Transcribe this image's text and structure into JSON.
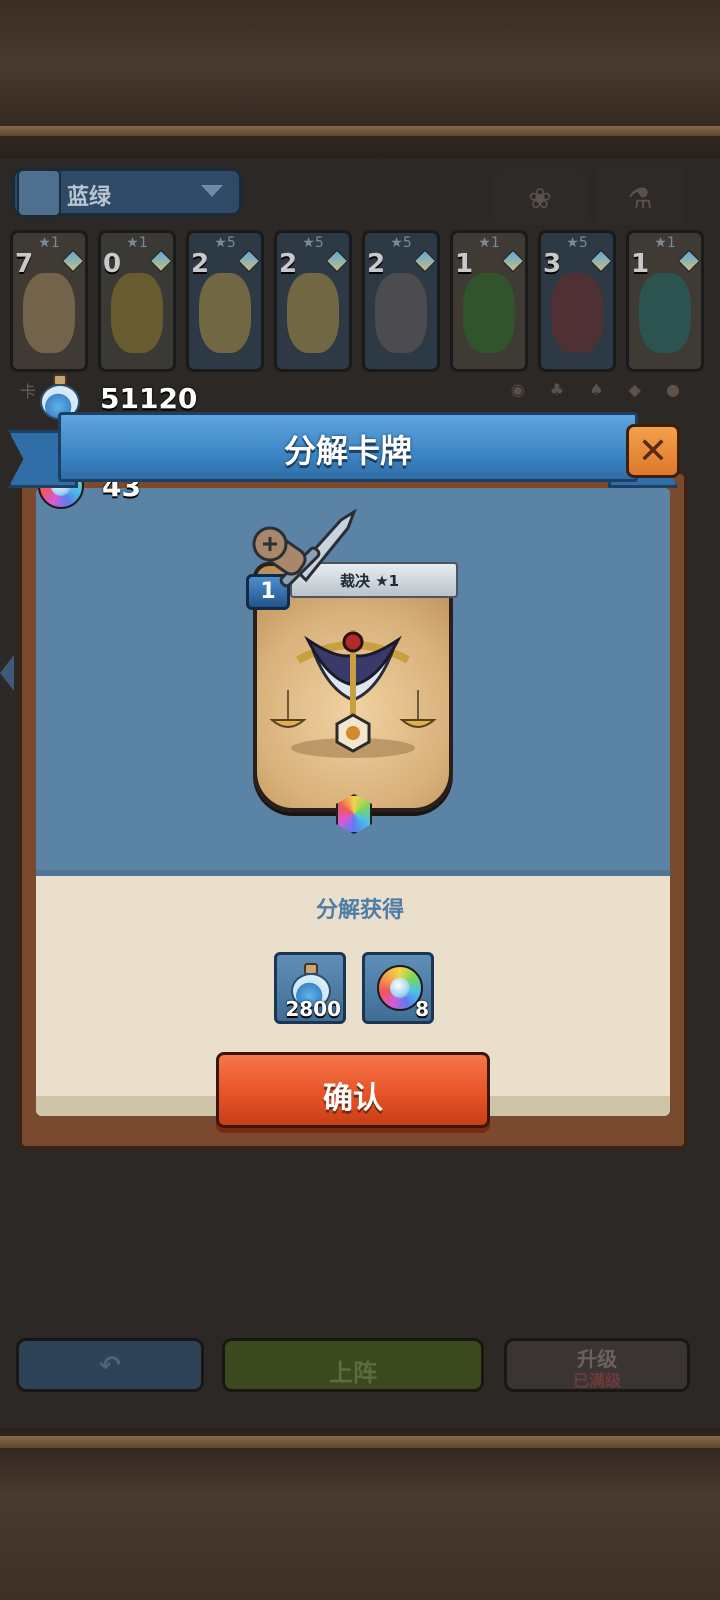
{
  "background": {
    "deck_selector": {
      "label": "蓝绿"
    },
    "tabs": [
      {
        "icon": "paw-icon"
      },
      {
        "icon": "potion-flask-icon"
      }
    ],
    "card_row": [
      {
        "stars": "★1",
        "count": "7",
        "art_color": "#c9a46a"
      },
      {
        "stars": "★1",
        "count": "0",
        "art_color": "#b99a3e"
      },
      {
        "stars": "★5",
        "count": "2",
        "art_color": "#d6b35a"
      },
      {
        "stars": "★5",
        "count": "2",
        "art_color": "#d6b35a"
      },
      {
        "stars": "★5",
        "count": "2",
        "art_color": "#7a6a6a"
      },
      {
        "stars": "★1",
        "count": "1",
        "art_color": "#3e8f3a"
      },
      {
        "stars": "★5",
        "count": "3",
        "art_color": "#8a3a3a"
      },
      {
        "stars": "★1",
        "count": "1",
        "art_color": "#2f7a78"
      }
    ],
    "card_count_prefix": "卡",
    "bottom_buttons": {
      "back_icon": "back-arrow-icon",
      "deploy": "上阵",
      "upgrade": "升级",
      "upgrade_status": "已满级"
    }
  },
  "currency": {
    "potion_amount": "51120",
    "gem_amount": "43"
  },
  "dialog": {
    "title": "分解卡牌",
    "close_icon": "close-icon",
    "card": {
      "level": "1",
      "name": "裁决 ★1"
    },
    "rewards_label": "分解获得",
    "rewards": [
      {
        "icon": "potion-icon",
        "qty": "2800"
      },
      {
        "icon": "rainbow-gem-icon",
        "qty": "8"
      }
    ],
    "confirm_label": "确认"
  },
  "colors": {
    "ribbon_blue": "#3d86c6",
    "confirm_orange": "#e65427",
    "close_orange": "#e0782c",
    "panel_blue": "#5a83a6",
    "panel_cream": "#e9dfcb",
    "label_blue": "#4f7da6"
  }
}
